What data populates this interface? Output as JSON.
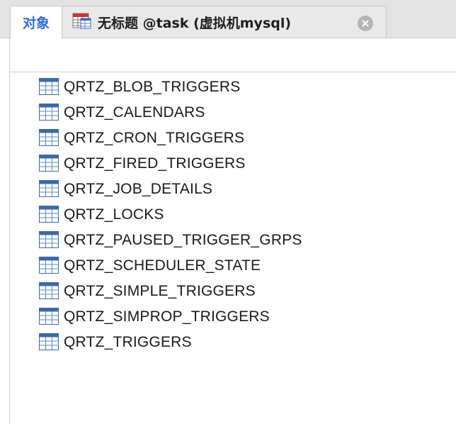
{
  "tabs": {
    "objects_label": "对象",
    "query_label": "无标题 @task (虚拟机mysql)"
  },
  "colors": {
    "accent": "#2f6fdc",
    "table_icon_header": "#3b6aa8",
    "table_icon_grid": "#5a87c5"
  },
  "icons": {
    "query_tab": "query-table-icon",
    "close": "close-icon",
    "list_item": "table-icon"
  },
  "tables": [
    {
      "name": "QRTZ_BLOB_TRIGGERS"
    },
    {
      "name": "QRTZ_CALENDARS"
    },
    {
      "name": "QRTZ_CRON_TRIGGERS"
    },
    {
      "name": "QRTZ_FIRED_TRIGGERS"
    },
    {
      "name": "QRTZ_JOB_DETAILS"
    },
    {
      "name": "QRTZ_LOCKS"
    },
    {
      "name": "QRTZ_PAUSED_TRIGGER_GRPS"
    },
    {
      "name": "QRTZ_SCHEDULER_STATE"
    },
    {
      "name": "QRTZ_SIMPLE_TRIGGERS"
    },
    {
      "name": "QRTZ_SIMPROP_TRIGGERS"
    },
    {
      "name": "QRTZ_TRIGGERS"
    }
  ]
}
